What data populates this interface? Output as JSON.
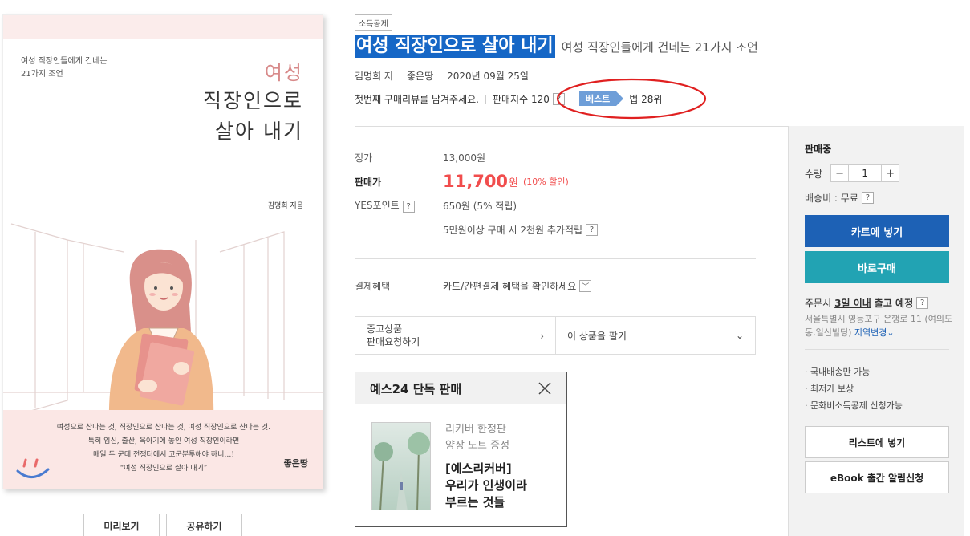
{
  "cover": {
    "subtitle": "여성 직장인들에게 건네는\n21가지 조언",
    "title_line1": "여성",
    "title_line2": "직장인으로",
    "title_line3": "살아 내기",
    "author": "김명희 지음",
    "quote_lines": [
      "여성으로 산다는 것, 직장인으로 산다는 것, 여성 직장인으로 산다는 것.",
      "특히 임신, 출산, 육아기에 놓인 여성 직장인이라면",
      "매일 두 군데 전쟁터에서 고군분투해야 하니…!",
      "“여성 직장인으로 살아 내기”"
    ],
    "publisher": "좋은땅"
  },
  "cover_buttons": {
    "preview": "미리보기",
    "share": "공유하기"
  },
  "product": {
    "tag": "소득공제",
    "title": "여성 직장인으로 살아 내기",
    "subtitle": "여성 직장인들에게 건네는 21가지 조언",
    "author": "김명희 저",
    "publisher": "좋은땅",
    "date": "2020년 09월 25일",
    "review_prompt": "첫번째 구매리뷰를 남겨주세요.",
    "sales_index": "판매지수 120",
    "best_label": "베스트",
    "best_rank": "법 28위"
  },
  "price": {
    "list_label": "정가",
    "list_value": "13,000원",
    "sale_label": "판매가",
    "sale_value": "11,700",
    "sale_unit": "원",
    "sale_discount": "(10% 할인)",
    "point_label": "YES포인트",
    "point_value": "650원 (5% 적립)",
    "extra_point": "5만원이상 구매 시 2천원 추가적립"
  },
  "payment": {
    "label": "결제혜택",
    "value": "카드/간편결제 혜택을 확인하세요"
  },
  "used": {
    "line1": "중고상품",
    "line2": "판매요청하기",
    "sell": "이 상품을 팔기"
  },
  "exclusive": {
    "header": "예스24 단독 판매",
    "gray1": "리커버 한정판",
    "gray2": "양장 노트 증정",
    "line1": "[예스리커버]",
    "line2": "우리가 인생이라",
    "line3": "부르는 것들"
  },
  "side": {
    "status": "판매중",
    "qty_label": "수량",
    "qty_value": "1",
    "shipping": "배송비 : 무료",
    "cart": "카트에 넣기",
    "buy": "바로구매",
    "order_prefix": "주문시",
    "order_days": "3일 이내",
    "order_suffix": "출고 예정",
    "address": "서울특별시 영등포구 은행로 11 (여의도동,일신빌딩)",
    "address_change": "지역변경",
    "bullets": [
      "· 국내배송만 가능",
      "· 최저가 보상",
      "· 문화비소득공제 신청가능"
    ],
    "wishlist": "리스트에 넣기",
    "ebook": "eBook 출간 알림신청"
  },
  "colors": {
    "title_highlight": "#1667c6",
    "sale_red": "#f14d4d",
    "cart_blue": "#1d61b5",
    "buy_teal": "#22a3b3",
    "best_badge": "#6e9ed8",
    "annotation_red": "#e02020"
  }
}
